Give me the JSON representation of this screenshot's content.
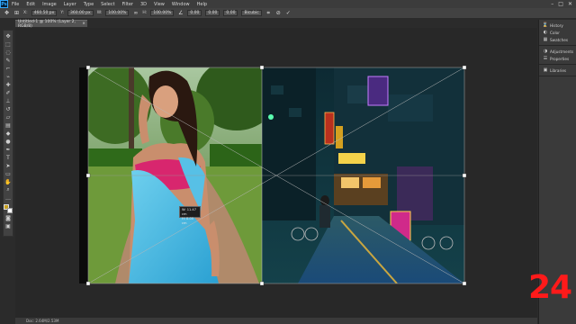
{
  "app": {
    "logo": "Ps",
    "menu": [
      "File",
      "Edit",
      "Image",
      "Layer",
      "Type",
      "Select",
      "Filter",
      "3D",
      "View",
      "Window",
      "Help"
    ],
    "window_controls": [
      "–",
      "□",
      "✕"
    ]
  },
  "options": {
    "x_label": "X:",
    "x_value": "460.50 px",
    "y_label": "Y:",
    "y_value": "360.00 px",
    "w_label": "W:",
    "w_value": "100.00%",
    "h_label": "H:",
    "h_value": "100.00%",
    "angle_value": "0.00",
    "interp": "Bicubic",
    "h_skew": "0.00",
    "v_skew": "0.00"
  },
  "document": {
    "tab_title": "Untitled-1 @ 100% (Layer 2, RGB/8)",
    "tab_close": "×"
  },
  "status": {
    "text": "Doc: 2.64M/2.53M"
  },
  "transform_tooltip": {
    "line1": "W: 11.47 cm",
    "line2": "H: 0.00 cm"
  },
  "panels": {
    "group1": [
      {
        "icon": "history-icon",
        "label": "History"
      },
      {
        "icon": "color-icon",
        "label": "Color"
      },
      {
        "icon": "swatches-icon",
        "label": "Swatches"
      }
    ],
    "group2": [
      {
        "icon": "adjustments-icon",
        "label": "Adjustments"
      },
      {
        "icon": "properties-icon",
        "label": "Properties"
      }
    ],
    "group3": [
      {
        "icon": "libraries-icon",
        "label": "Libraries"
      }
    ]
  },
  "overlay_number": "24",
  "colors": {
    "foreground": "#c7a021",
    "background": "#ffffff",
    "accent_red": "#ff1a1a"
  }
}
